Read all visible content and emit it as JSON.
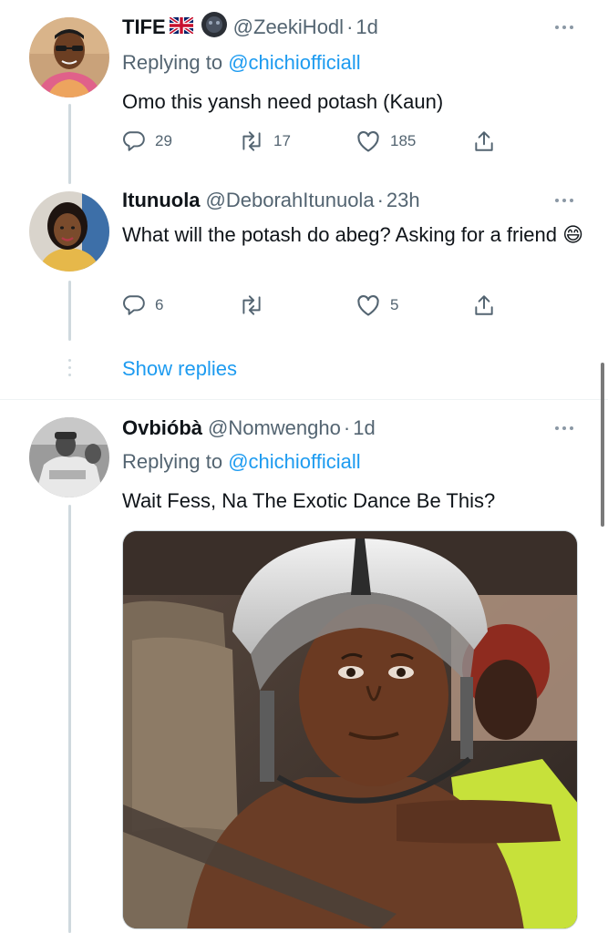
{
  "tweets": [
    {
      "name": "TIFE",
      "handle": "@ZeekiHodl",
      "time": "1d",
      "replying_label": "Replying to",
      "replying_to": "@chichiofficiall",
      "text": "Omo this yansh need potash (Kaun)",
      "reply_count": "29",
      "retweet_count": "17",
      "like_count": "185"
    },
    {
      "name": "Itunuola",
      "handle": "@DeborahItunuola",
      "time": "23h",
      "text": "What will the potash do abeg? Asking for a friend",
      "emoji": "😄",
      "reply_count": "6",
      "retweet_count": "",
      "like_count": "5"
    },
    {
      "name": "Ovbióbà",
      "handle": "@Nomwengho",
      "time": "1d",
      "replying_label": "Replying to",
      "replying_to": "@chichiofficiall",
      "text": "Wait Fess, Na The Exotic Dance Be This?"
    }
  ],
  "thread": {
    "show_replies": "Show replies"
  },
  "separator": "·",
  "colors": {
    "accent": "#1d9bf0",
    "secondary_text": "#536471",
    "primary_text": "#0f1419",
    "line": "#cfd9de"
  },
  "icons": [
    "reply-icon",
    "retweet-icon",
    "like-icon",
    "share-icon",
    "more-icon",
    "uk-flag-icon",
    "dark-circle-badge-icon"
  ]
}
